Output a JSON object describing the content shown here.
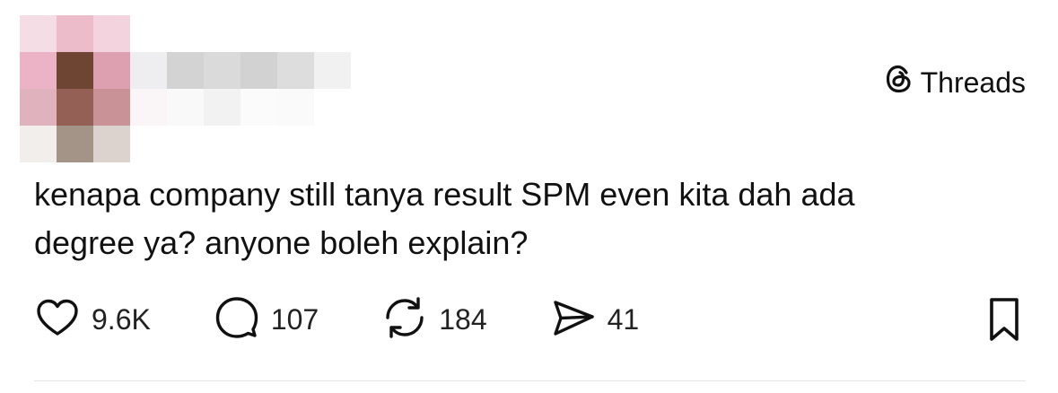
{
  "brand": {
    "name": "Threads",
    "icon": "threads-logo-icon"
  },
  "post": {
    "lines": [
      "kenapa company still tanya result SPM even kita dah ada",
      "degree ya? anyone boleh explain?"
    ]
  },
  "actions": {
    "like": {
      "icon": "heart-icon",
      "count": "9.6K"
    },
    "reply": {
      "icon": "comment-icon",
      "count": "107"
    },
    "repost": {
      "icon": "repost-icon",
      "count": "184"
    },
    "share": {
      "icon": "send-icon",
      "count": "41"
    },
    "bookmark": {
      "icon": "bookmark-icon"
    }
  },
  "colors": {
    "text": "#111111",
    "divider": "#e4e4e4",
    "background": "#ffffff"
  }
}
